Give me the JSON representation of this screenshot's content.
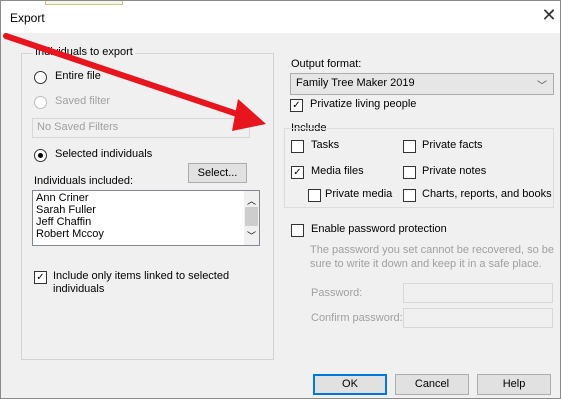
{
  "window": {
    "title": "Export"
  },
  "left": {
    "group_label": "Individuals to export",
    "radio_entire": "Entire file",
    "radio_saved": "Saved filter",
    "saved_filters_value": "No Saved Filters",
    "radio_selected": "Selected individuals",
    "included_label": "Individuals included:",
    "select_button": "Select...",
    "individuals": [
      "Ann Criner",
      "Sarah Fuller",
      "Jeff Chaffin",
      "Robert Mccoy"
    ],
    "linked_line1": "Include only items linked  to selected",
    "linked_line2": "individuals"
  },
  "right": {
    "output_format_label": "Output format:",
    "output_format_value": "Family Tree Maker 2019",
    "privatize_label": "Privatize living people",
    "include_label": "Include",
    "tasks": "Tasks",
    "private_facts": "Private facts",
    "media_files": "Media files",
    "private_notes": "Private notes",
    "private_media": "Private media",
    "charts": "Charts, reports, and books",
    "enable_password": "Enable password protection",
    "password_note_1": "The password you set cannot be recovered, so be",
    "password_note_2": "sure to write it down and keep it in a safe place.",
    "password_label": "Password:",
    "confirm_label": "Confirm password:"
  },
  "buttons": {
    "ok": "OK",
    "cancel": "Cancel",
    "help": "Help"
  },
  "icons": {
    "close": "close-icon",
    "dropdown": "chevron-down-icon",
    "scroll_up": "chevron-up-icon",
    "scroll_down": "chevron-down-icon",
    "checkmark": "checkmark-icon"
  },
  "colors": {
    "annotation_arrow": "#e8141e",
    "default_button_border": "#0078d7"
  },
  "checkbox_states": {
    "privatize": true,
    "tasks": false,
    "private_facts": false,
    "media_files": true,
    "private_notes": false,
    "private_media": false,
    "charts": false,
    "enable_password": false,
    "linked_only": true
  },
  "radio_states": {
    "entire_file": false,
    "saved_filter": false,
    "selected_individuals": true
  }
}
